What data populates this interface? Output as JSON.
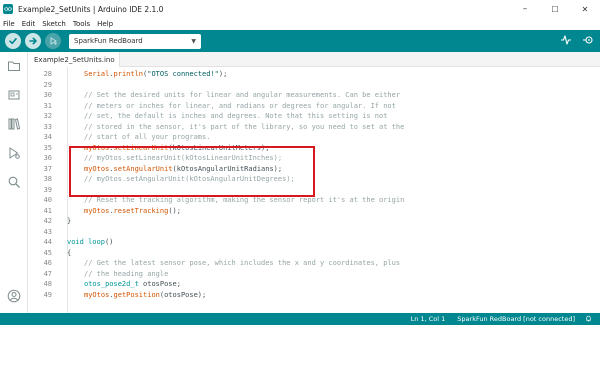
{
  "window": {
    "title": "Example2_SetUnits | Arduino IDE 2.1.0",
    "controls": {
      "minimize": "–",
      "maximize": "☐",
      "close": "✕"
    }
  },
  "menu": [
    "File",
    "Edit",
    "Sketch",
    "Tools",
    "Help"
  ],
  "toolbar": {
    "board": "SparkFun RedBoard",
    "icons": [
      "verify-icon",
      "upload-icon",
      "debug-icon",
      "serial-plotter-icon",
      "serial-monitor-icon"
    ]
  },
  "sidebar": {
    "icons": [
      "sketchbook-folder-icon",
      "boards-manager-icon",
      "library-manager-icon",
      "debug-icon",
      "search-icon",
      "account-icon"
    ]
  },
  "tabs": [
    {
      "label": "Example2_SetUnits.ino"
    }
  ],
  "code": [
    {
      "num": "28",
      "indent": 1,
      "parts": [
        [
          "fn",
          "Serial"
        ],
        [
          "txt",
          "."
        ],
        [
          "fn",
          "println"
        ],
        [
          "txt",
          "("
        ],
        [
          "str",
          "\"OTOS connected!\""
        ],
        [
          "txt",
          ");"
        ]
      ]
    },
    {
      "num": "29",
      "indent": 0,
      "parts": []
    },
    {
      "num": "30",
      "indent": 1,
      "parts": [
        [
          "com",
          "// Set the desired units for linear and angular measurements. Can be either"
        ]
      ]
    },
    {
      "num": "31",
      "indent": 1,
      "parts": [
        [
          "com",
          "// meters or inches for linear, and radians or degrees for angular. If not"
        ]
      ]
    },
    {
      "num": "32",
      "indent": 1,
      "parts": [
        [
          "com",
          "// set, the default is inches and degrees. Note that this setting is not"
        ]
      ]
    },
    {
      "num": "33",
      "indent": 1,
      "parts": [
        [
          "com",
          "// stored in the sensor, it's part of the library, so you need to set at the"
        ]
      ]
    },
    {
      "num": "34",
      "indent": 1,
      "parts": [
        [
          "com",
          "// start of all your programs."
        ]
      ]
    },
    {
      "num": "35",
      "indent": 1,
      "parts": [
        [
          "fn",
          "myOtos"
        ],
        [
          "txt",
          "."
        ],
        [
          "fn",
          "setLinearUnit"
        ],
        [
          "txt",
          "(kOtosLinearUnitMeters);"
        ]
      ]
    },
    {
      "num": "36",
      "indent": 1,
      "parts": [
        [
          "com",
          "// myOtos.setLinearUnit(kOtosLinearUnitInches);"
        ]
      ]
    },
    {
      "num": "37",
      "indent": 1,
      "parts": [
        [
          "fn",
          "myOtos"
        ],
        [
          "txt",
          "."
        ],
        [
          "fn",
          "setAngularUnit"
        ],
        [
          "txt",
          "(kOtosAngularUnitRadians);"
        ]
      ]
    },
    {
      "num": "38",
      "indent": 1,
      "parts": [
        [
          "com",
          "// myOtos.setAngularUnit(kOtosAngularUnitDegrees);"
        ]
      ]
    },
    {
      "num": "39",
      "indent": 0,
      "parts": []
    },
    {
      "num": "40",
      "indent": 1,
      "parts": [
        [
          "com",
          "// Reset the tracking algorithm, making the sensor report it's at the origin"
        ]
      ]
    },
    {
      "num": "41",
      "indent": 1,
      "parts": [
        [
          "fn",
          "myOtos"
        ],
        [
          "txt",
          "."
        ],
        [
          "fn",
          "resetTracking"
        ],
        [
          "txt",
          "();"
        ]
      ]
    },
    {
      "num": "42",
      "indent": 0,
      "parts": [
        [
          "txt",
          "}"
        ]
      ]
    },
    {
      "num": "43",
      "indent": 0,
      "parts": []
    },
    {
      "num": "44",
      "indent": 0,
      "parts": [
        [
          "kw",
          "void"
        ],
        [
          "txt",
          " "
        ],
        [
          "kw",
          "loop"
        ],
        [
          "txt",
          "()"
        ]
      ]
    },
    {
      "num": "45",
      "indent": 0,
      "parts": [
        [
          "txt",
          "{"
        ]
      ]
    },
    {
      "num": "46",
      "indent": 1,
      "parts": [
        [
          "com",
          "// Get the latest sensor pose, which includes the x and y coordinates, plus"
        ]
      ]
    },
    {
      "num": "47",
      "indent": 1,
      "parts": [
        [
          "com",
          "// the heading angle"
        ]
      ]
    },
    {
      "num": "48",
      "indent": 1,
      "parts": [
        [
          "kw",
          "otos_pose2d_t"
        ],
        [
          "txt",
          " otosPose;"
        ]
      ]
    },
    {
      "num": "49",
      "indent": 1,
      "parts": [
        [
          "fn",
          "myOtos"
        ],
        [
          "txt",
          "."
        ],
        [
          "fn",
          "getPosition"
        ],
        [
          "txt",
          "(otosPose);"
        ]
      ]
    }
  ],
  "status": {
    "position": "Ln 1, Col 1",
    "board": "SparkFun RedBoard [not connected]"
  },
  "colors": {
    "teal": "#00878f",
    "highlight": "#d6191f",
    "comment": "#95a5a6",
    "function": "#d35400",
    "keyword": "#00979c"
  }
}
